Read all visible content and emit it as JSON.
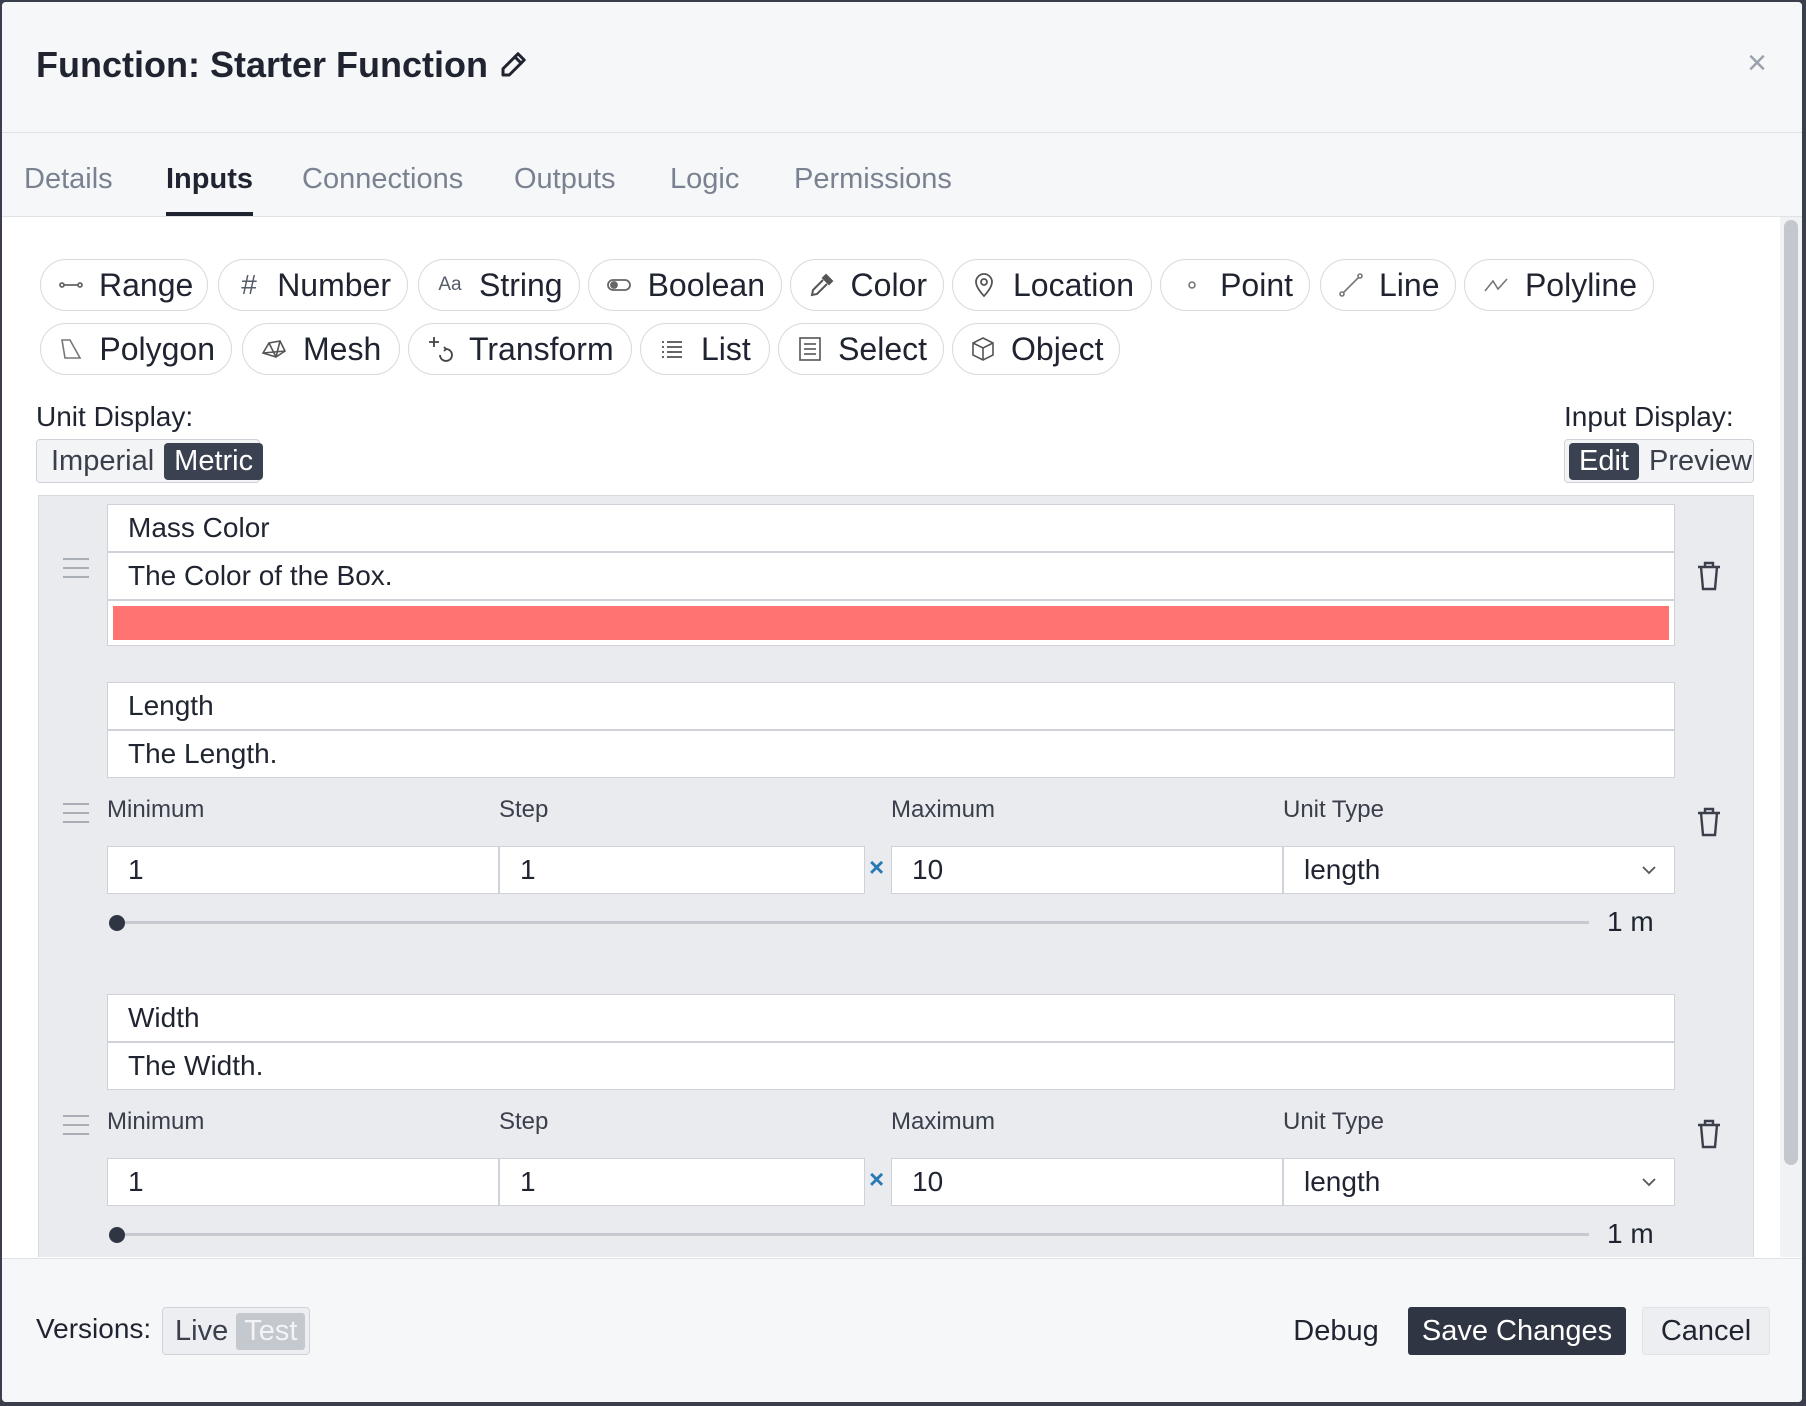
{
  "header": {
    "title": "Function: Starter Function",
    "close_label": "×"
  },
  "tabs": [
    {
      "label": "Details"
    },
    {
      "label": "Inputs"
    },
    {
      "label": "Connections"
    },
    {
      "label": "Outputs"
    },
    {
      "label": "Logic"
    },
    {
      "label": "Permissions"
    }
  ],
  "active_tab": "Inputs",
  "input_types": [
    {
      "label": "Range",
      "icon": "range-icon"
    },
    {
      "label": "Number",
      "icon": "hash-icon"
    },
    {
      "label": "String",
      "icon": "text-icon"
    },
    {
      "label": "Boolean",
      "icon": "toggle-icon"
    },
    {
      "label": "Color",
      "icon": "eyedropper-icon"
    },
    {
      "label": "Location",
      "icon": "map-pin-icon"
    },
    {
      "label": "Point",
      "icon": "dot-icon"
    },
    {
      "label": "Line",
      "icon": "line-icon"
    },
    {
      "label": "Polyline",
      "icon": "polyline-icon"
    },
    {
      "label": "Polygon",
      "icon": "polygon-icon"
    },
    {
      "label": "Mesh",
      "icon": "mesh-icon"
    },
    {
      "label": "Transform",
      "icon": "transform-icon"
    },
    {
      "label": "List",
      "icon": "list-icon"
    },
    {
      "label": "Select",
      "icon": "select-icon"
    },
    {
      "label": "Object",
      "icon": "cube-icon"
    }
  ],
  "unit_display": {
    "label": "Unit Display:",
    "options": [
      "Imperial",
      "Metric"
    ],
    "selected": "Metric"
  },
  "input_display": {
    "label": "Input Display:",
    "options": [
      "Edit",
      "Preview"
    ],
    "selected": "Edit"
  },
  "inputs": [
    {
      "name": "Mass Color",
      "description": "The Color of the Box.",
      "type": "color",
      "color": "#ff7373"
    },
    {
      "name": "Length",
      "description": "The Length.",
      "type": "range",
      "labels": {
        "minimum": "Minimum",
        "step": "Step",
        "maximum": "Maximum",
        "unit_type": "Unit Type"
      },
      "minimum": "1",
      "step": "1",
      "step_symbol": "×",
      "maximum": "10",
      "unit_type": "length",
      "slider_value_text": "1 m",
      "slider_fraction": 0
    },
    {
      "name": "Width",
      "description": "The Width.",
      "type": "range",
      "labels": {
        "minimum": "Minimum",
        "step": "Step",
        "maximum": "Maximum",
        "unit_type": "Unit Type"
      },
      "minimum": "1",
      "step": "1",
      "step_symbol": "×",
      "maximum": "10",
      "unit_type": "length",
      "slider_value_text": "1 m",
      "slider_fraction": 0
    }
  ],
  "footer": {
    "versions_label": "Versions:",
    "versions": [
      "Live",
      "Test"
    ],
    "debug_label": "Debug",
    "save_label": "Save Changes",
    "cancel_label": "Cancel"
  },
  "colors": {
    "primary": "#2f3542",
    "accent_blue": "#2a79b4",
    "mass_color": "#ff7373"
  }
}
